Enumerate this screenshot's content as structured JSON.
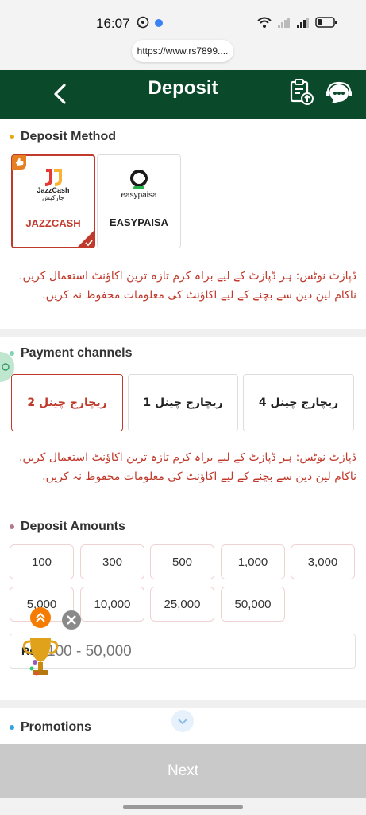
{
  "status_bar": {
    "time": "16:07",
    "url": "https://www.rs7899....",
    "icons": [
      "whatsapp-icon",
      "app-icon",
      "wifi-icon",
      "signal-icon",
      "signal-icon",
      "battery-icon"
    ]
  },
  "header": {
    "title": "Deposit",
    "back_icon": "chevron-left-icon",
    "record_icon": "clipboard-upload-icon",
    "support_icon": "chat-support-icon",
    "bg_color": "#0a4a2a"
  },
  "deposit_method": {
    "title": "Deposit Method",
    "dot_color": "#e6a817",
    "methods": [
      {
        "name": "JAZZCASH",
        "logo_text": "JazzCash",
        "logo_sub": "جازکیش",
        "selected": true
      },
      {
        "name": "EASYPAISA",
        "logo_text": "easypaisa",
        "selected": false
      }
    ]
  },
  "notice_text": "ڈپازٹ نوٹس: ہر ڈپازٹ کے لیے براہ کرم تازہ ترین اکاؤنٹ استعمال کریں. ناکام لین دین سے بچنے کے لیے اکاؤنٹ کی معلومات محفوظ نہ کریں.",
  "payment_channels": {
    "title": "Payment channels",
    "dot_color": "#7fd3b3",
    "channels": [
      {
        "label": "ریچارج چینل 2",
        "selected": true
      },
      {
        "label": "ریچارج چینل 1",
        "selected": false
      },
      {
        "label": "ریچارج چینل 4",
        "selected": false
      }
    ]
  },
  "notice_text_2": "ڈپازٹ نوٹس: ہر ڈپازٹ کے لیے براہ کرم تازہ ترین اکاؤنٹ استعمال کریں. ناکام لین دین سے بچنے کے لیے اکاؤنٹ کی معلومات محفوظ نہ کریں.",
  "deposit_amounts": {
    "title": "Deposit Amounts",
    "dot_color": "#b07a8a",
    "amounts": [
      "100",
      "300",
      "500",
      "1,000",
      "3,000",
      "5,000",
      "10,000",
      "25,000",
      "50,000"
    ]
  },
  "amount_input": {
    "prefix": "Rs",
    "placeholder": "100 - 50,000"
  },
  "promotions": {
    "title": "Promotions",
    "dot_color": "#2fa3e0"
  },
  "next_button": {
    "label": "Next",
    "color": "#c9c9c9"
  },
  "accent_color": "#c0392b"
}
